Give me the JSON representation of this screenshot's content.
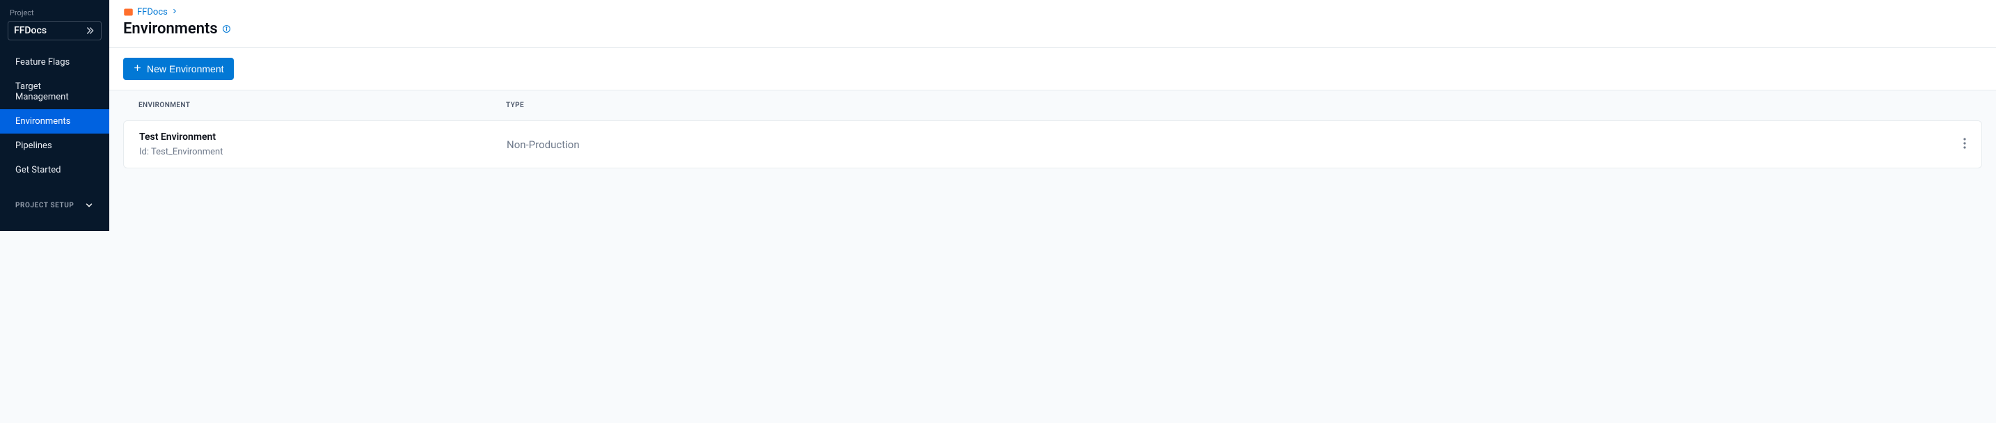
{
  "sidebar": {
    "project_label": "Project",
    "project_name": "FFDocs",
    "nav": [
      {
        "label": "Feature Flags",
        "active": false
      },
      {
        "label": "Target Management",
        "active": false
      },
      {
        "label": "Environments",
        "active": true
      },
      {
        "label": "Pipelines",
        "active": false
      },
      {
        "label": "Get Started",
        "active": false
      }
    ],
    "setup_label": "PROJECT SETUP"
  },
  "header": {
    "breadcrumb_project": "FFDocs",
    "title": "Environments"
  },
  "toolbar": {
    "new_button": "New Environment"
  },
  "table": {
    "headers": {
      "env": "ENVIRONMENT",
      "type": "TYPE"
    },
    "rows": [
      {
        "name": "Test Environment",
        "id_label": "Id: Test_Environment",
        "type": "Non-Production"
      }
    ]
  }
}
